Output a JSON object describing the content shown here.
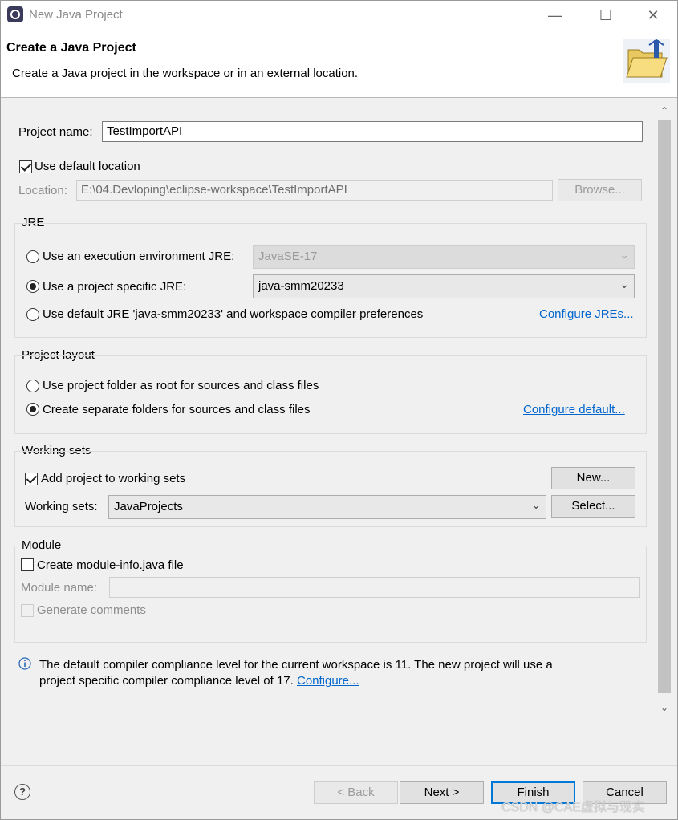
{
  "window": {
    "title": "New Java Project",
    "minimize_icon": "minimize-icon",
    "maximize_icon": "maximize-icon",
    "close_icon": "close-icon"
  },
  "header": {
    "title": "Create a Java Project",
    "description": "Create a Java project in the workspace or in an external location.",
    "banner_icon": "folder-icon"
  },
  "project": {
    "name_label": "Project name:",
    "name_value": "TestImportAPI",
    "use_default_location_label": "Use default location",
    "use_default_location_checked": true,
    "location_label": "Location:",
    "location_value": "E:\\04.Devloping\\eclipse-workspace\\TestImportAPI",
    "browse_label": "Browse..."
  },
  "jre": {
    "group_title": "JRE",
    "option_exec_env_label": "Use an execution environment JRE:",
    "exec_env_value": "JavaSE-17",
    "option_project_specific_label": "Use a project specific JRE:",
    "project_specific_value": "java-smm20233",
    "option_default_label": "Use default JRE 'java-smm20233' and workspace compiler preferences",
    "configure_link": "Configure JREs...",
    "selected": "project_specific"
  },
  "layout": {
    "group_title": "Project layout",
    "option_root_label": "Use project folder as root for sources and class files",
    "option_separate_label": "Create separate folders for sources and class files",
    "configure_link": "Configure default...",
    "selected": "separate"
  },
  "working_sets": {
    "group_title": "Working sets",
    "add_label": "Add project to working sets",
    "add_checked": true,
    "new_button": "New...",
    "sets_label": "Working sets:",
    "sets_value": "JavaProjects",
    "select_button": "Select..."
  },
  "module": {
    "group_title": "Module",
    "create_label": "Create module-info.java file",
    "create_checked": false,
    "name_label": "Module name:",
    "name_value": "",
    "generate_comments_label": "Generate comments"
  },
  "info": {
    "icon": "info-icon",
    "line1": "The default compiler compliance level for the current workspace is 11. The new project will use a",
    "line2": "project specific compiler compliance level of 17.",
    "configure_link": "Configure..."
  },
  "footer": {
    "help_icon": "help-icon",
    "help_glyph": "?",
    "back": "< Back",
    "next": "Next >",
    "finish": "Finish",
    "cancel": "Cancel",
    "watermark": "CSDN @CAE虚拟与现实"
  },
  "colors": {
    "link": "#0066cc",
    "default_button_border": "#0078d7",
    "dialog_background": "#f0f0f0"
  }
}
